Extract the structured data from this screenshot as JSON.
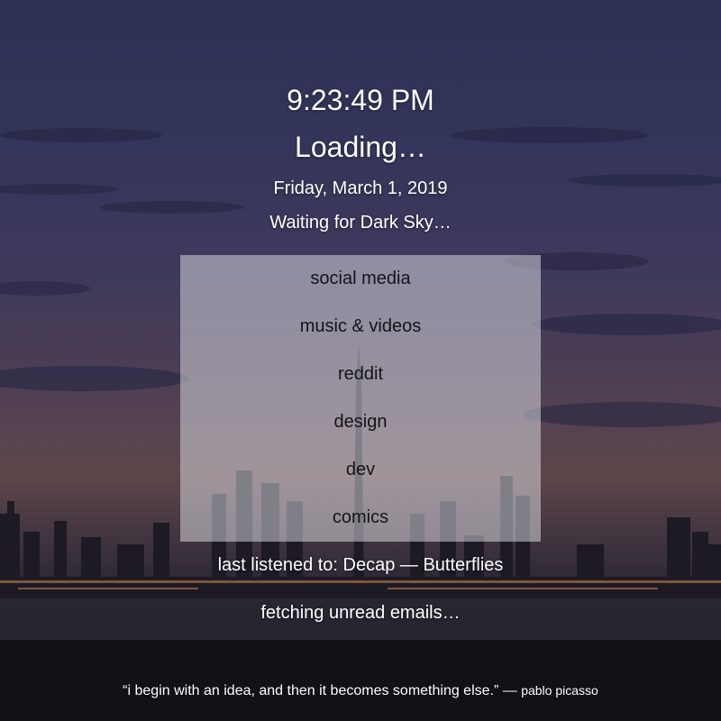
{
  "clock": {
    "time": "9:23:49 PM"
  },
  "weather": {
    "status": "Loading…",
    "note": "Waiting for Dark Sky…"
  },
  "date": {
    "text": "Friday, March 1, 2019"
  },
  "menu": {
    "items": [
      {
        "label": "social media"
      },
      {
        "label": "music & videos"
      },
      {
        "label": "reddit"
      },
      {
        "label": "design"
      },
      {
        "label": "dev"
      },
      {
        "label": "comics"
      }
    ]
  },
  "music": {
    "last_listened": "last listened to: Decap — Butterflies"
  },
  "email": {
    "status": "fetching unread emails…"
  },
  "quote": {
    "text": "“i begin with an idea, and then it becomes something else.” — ",
    "author": "pablo picasso"
  },
  "colors": {
    "sky_top": "#2e2f54",
    "horizon_glow": "#5e4548",
    "ground": "#18171e",
    "menu_panel": "rgba(220, 220, 228, 0.52)",
    "text": "#ffffff",
    "menu_text": "#141418"
  }
}
